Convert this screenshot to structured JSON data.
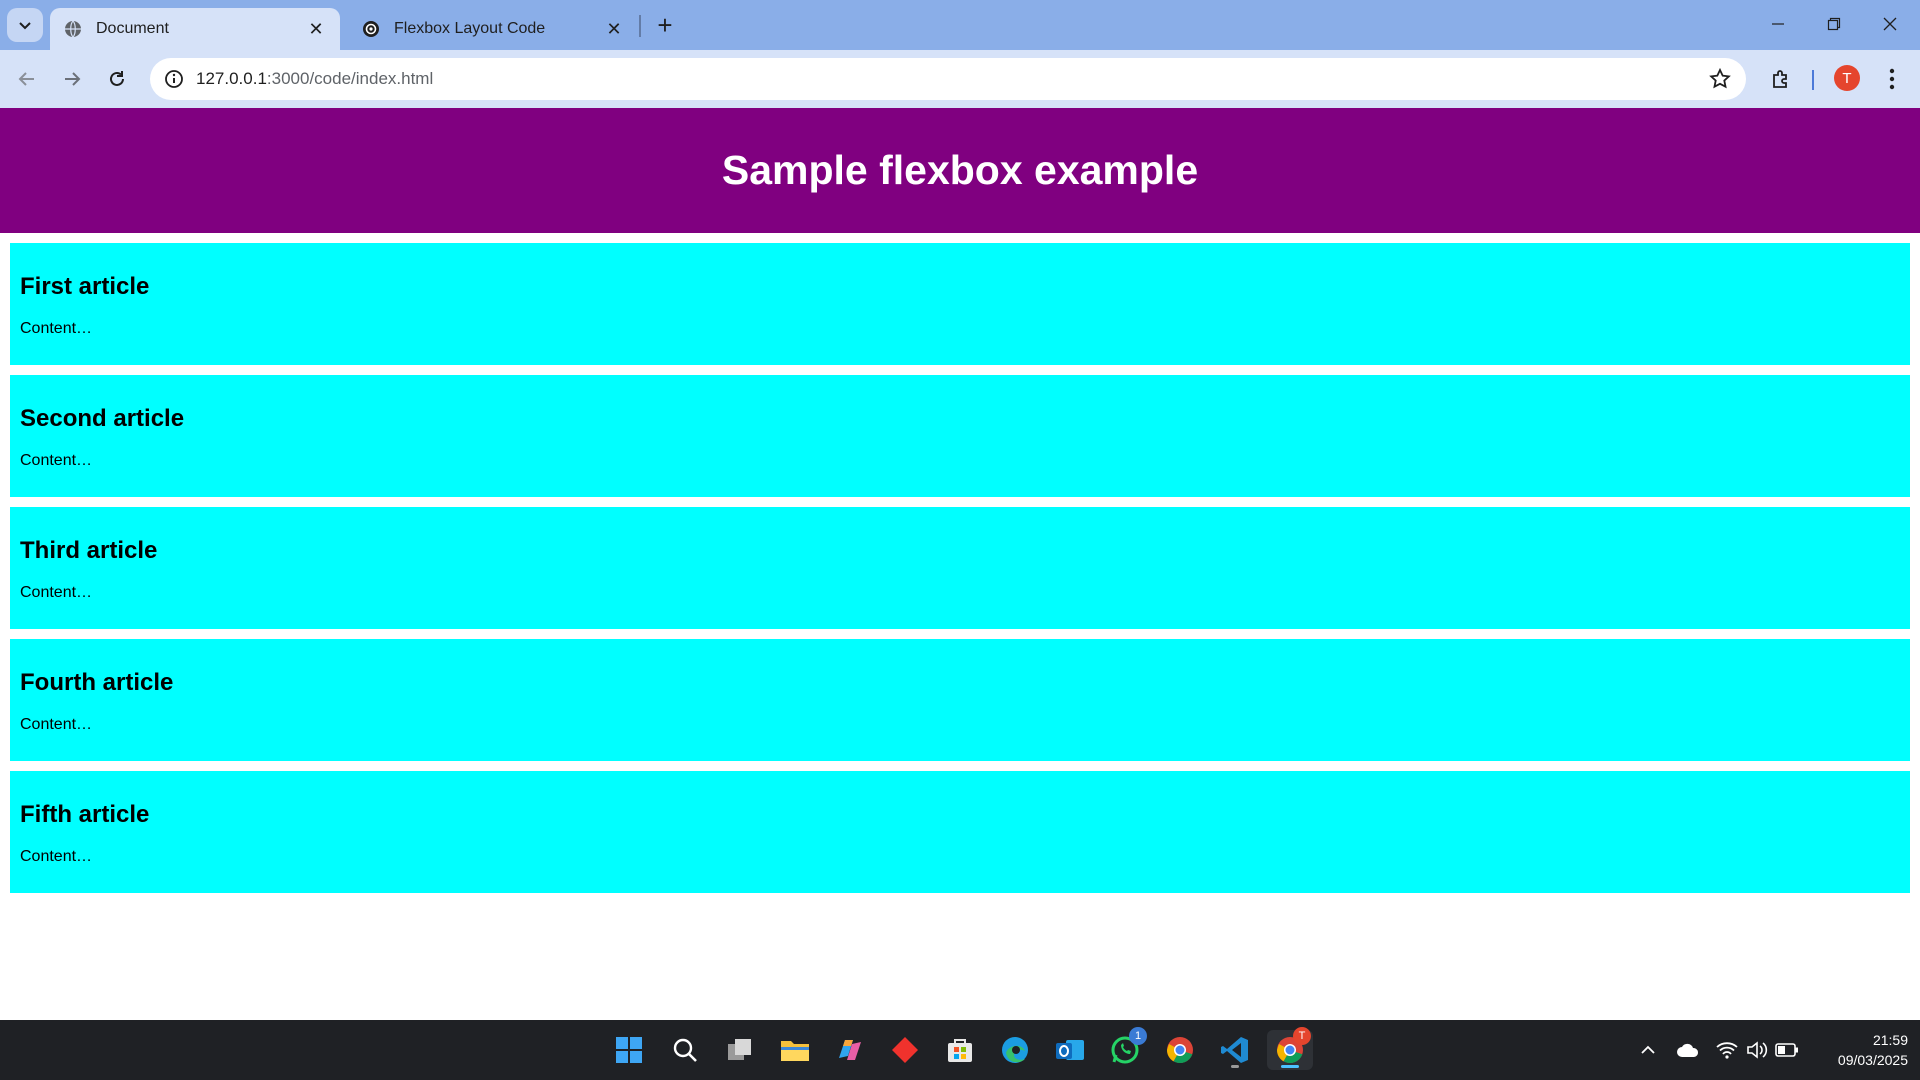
{
  "browser": {
    "tabs": [
      {
        "title": "Document",
        "active": true
      },
      {
        "title": "Flexbox Layout Code",
        "active": false
      }
    ],
    "address": {
      "host": "127.0.0.1",
      "path": ":3000/code/index.html"
    },
    "profile_initial": "T"
  },
  "page": {
    "heading": "Sample flexbox example",
    "articles": [
      {
        "title": "First article",
        "content": "Content…"
      },
      {
        "title": "Second article",
        "content": "Content…"
      },
      {
        "title": "Third article",
        "content": "Content…"
      },
      {
        "title": "Fourth article",
        "content": "Content…"
      },
      {
        "title": "Fifth article",
        "content": "Content…"
      }
    ],
    "colors": {
      "header": "#800080",
      "article": "#00ffff"
    }
  },
  "taskbar": {
    "apps": [
      "start",
      "search",
      "task-view",
      "file-explorer",
      "copilot",
      "git",
      "microsoft-store",
      "edge",
      "outlook",
      "whatsapp",
      "chrome",
      "vscode",
      "chrome-profile"
    ],
    "whatsapp_badge": "1",
    "chrome_profile_badge": "T",
    "time": "21:59",
    "date": "09/03/2025"
  }
}
